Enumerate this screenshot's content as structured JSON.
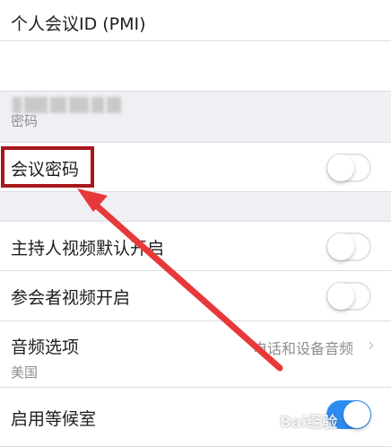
{
  "pmi": {
    "title": "个人会议ID (PMI)"
  },
  "password_section": {
    "header": "密码"
  },
  "meeting_password": {
    "label": "会议密码",
    "enabled": false
  },
  "host_video": {
    "label": "主持人视频默认开启",
    "enabled": false
  },
  "participant_video": {
    "label": "参会者视频开启",
    "enabled": false
  },
  "audio": {
    "label": "音频选项",
    "value": "电话和设备音频",
    "region": "美国"
  },
  "waiting_room": {
    "label": "启用等候室",
    "enabled": true
  },
  "colors": {
    "accent": "#2d8cf0",
    "highlight": "#a8181b",
    "arrow": "#e8393a"
  },
  "watermark": "Bai经验"
}
